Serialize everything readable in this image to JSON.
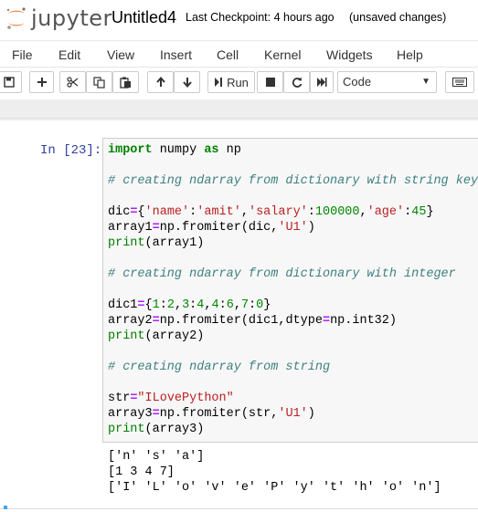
{
  "header": {
    "brand": "jupyter",
    "notebook_name": "Untitled4",
    "checkpoint": "Last Checkpoint: 4 hours ago",
    "status": "(unsaved changes)",
    "logo_color": "#f37726"
  },
  "menu": {
    "items": [
      "File",
      "Edit",
      "View",
      "Insert",
      "Cell",
      "Kernel",
      "Widgets",
      "Help"
    ]
  },
  "toolbar": {
    "run_label": "Run",
    "cell_type": "Code",
    "icons": [
      "save-icon",
      "plus-icon",
      "cut-icon",
      "copy-icon",
      "paste-icon",
      "arrow-up-icon",
      "arrow-down-icon",
      "step-forward-icon",
      "stop-icon",
      "restart-icon",
      "fast-forward-icon",
      "keyboard-icon"
    ]
  },
  "cell": {
    "prompt": "In [23]:",
    "code_lines": [
      "import numpy as np",
      "",
      "# creating ndarray from dictionary with string keys",
      "",
      "dic={'name':'amit','salary':100000,'age':45}",
      "array1=np.fromiter(dic,'U1')",
      "print(array1)",
      "",
      "# creating ndarray from dictionary with integer",
      "",
      "dic1={1:2,3:4,4:6,7:0}",
      "array2=np.fromiter(dic1,dtype=np.int32)",
      "print(array2)",
      "",
      "# creating ndarray from string",
      "",
      "str=\"ILovePython\"",
      "array3=np.fromiter(str,'U1')",
      "print(array3)"
    ],
    "output_lines": [
      "['n' 's' 'a']",
      "[1 3 4 7]",
      "['I' 'L' 'o' 'v' 'e' 'P' 'y' 't' 'h' 'o' 'n']"
    ]
  }
}
